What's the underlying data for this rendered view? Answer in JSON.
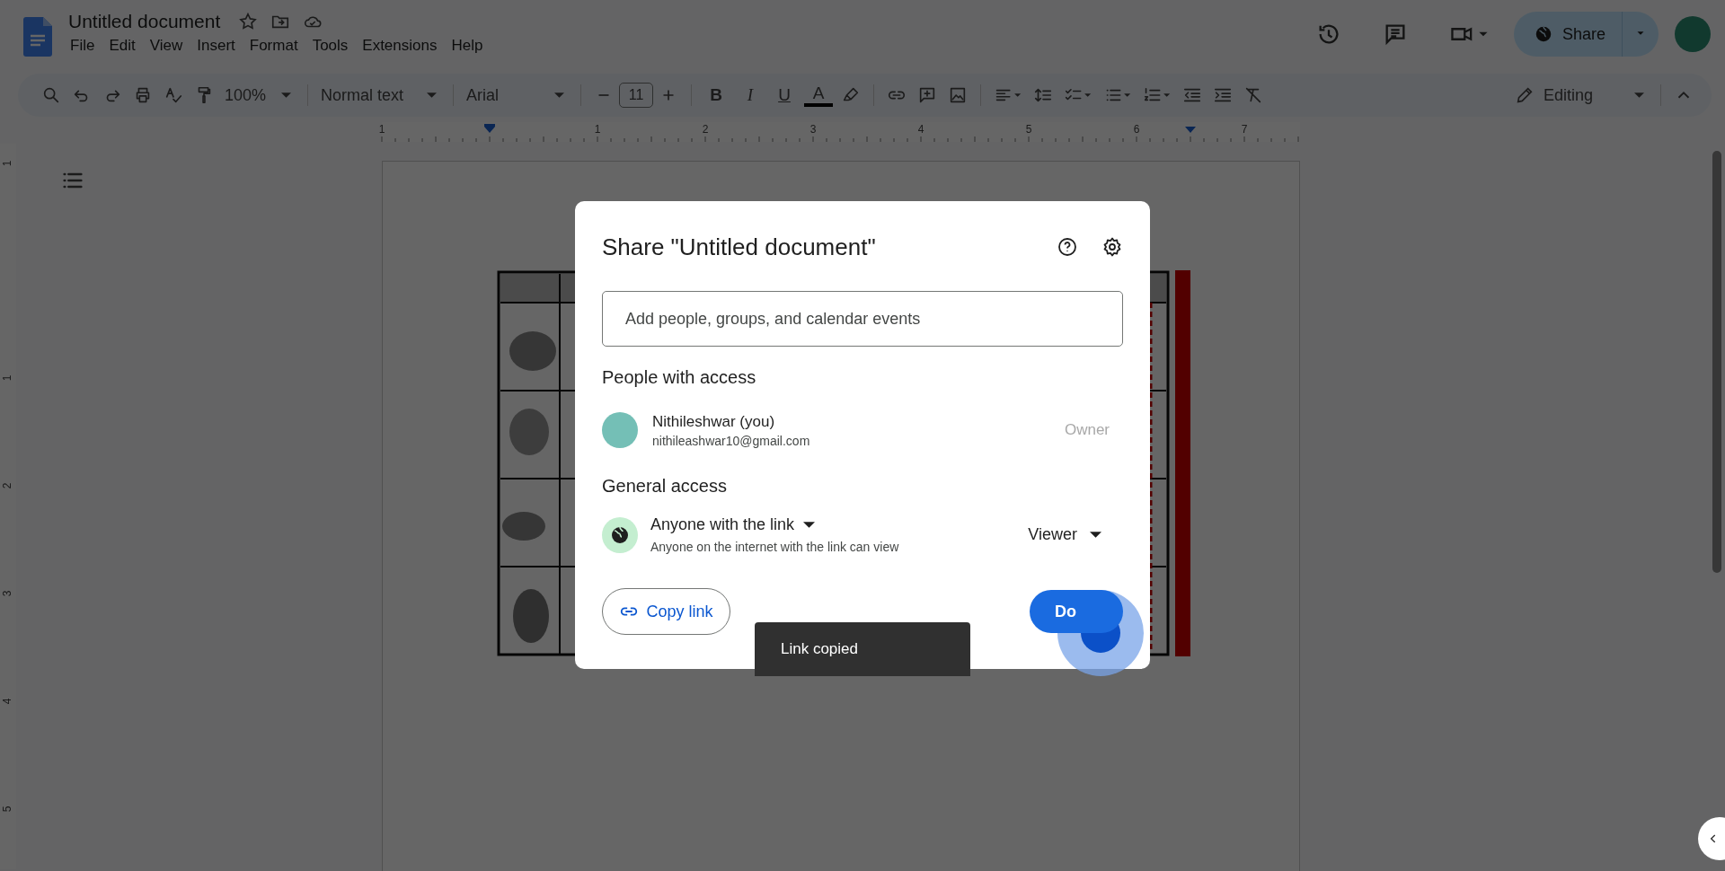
{
  "document": {
    "title": "Untitled document",
    "menu": [
      "File",
      "Edit",
      "View",
      "Insert",
      "Format",
      "Tools",
      "Extensions",
      "Help"
    ]
  },
  "share_button": {
    "label": "Share"
  },
  "toolbar": {
    "zoom": "100%",
    "style": "Normal text",
    "font": "Arial",
    "font_size": "11",
    "format_marks": [
      "B",
      "I",
      "U",
      "A"
    ],
    "mode": "Editing"
  },
  "ruler": {
    "numbers": [
      "1",
      "1",
      "2",
      "3",
      "4",
      "5",
      "6",
      "7"
    ]
  },
  "side_ruler": {
    "numbers": [
      "1",
      "1",
      "2",
      "3",
      "4",
      "5"
    ]
  },
  "dialog": {
    "title": "Share \"Untitled document\"",
    "add_field": {
      "placeholder": "Add people, groups, and calendar events"
    },
    "people_heading": "People with access",
    "people": [
      {
        "name": "Nithileshwar (you)",
        "email": "nithileashwar10@gmail.com",
        "role": "Owner"
      }
    ],
    "general_heading": "General access",
    "access": {
      "scope": "Anyone with the link",
      "description": "Anyone on the internet with the link can view",
      "role": "Viewer"
    },
    "copy_link": "Copy link",
    "done": "Do"
  },
  "toast": {
    "message": "Link copied"
  }
}
